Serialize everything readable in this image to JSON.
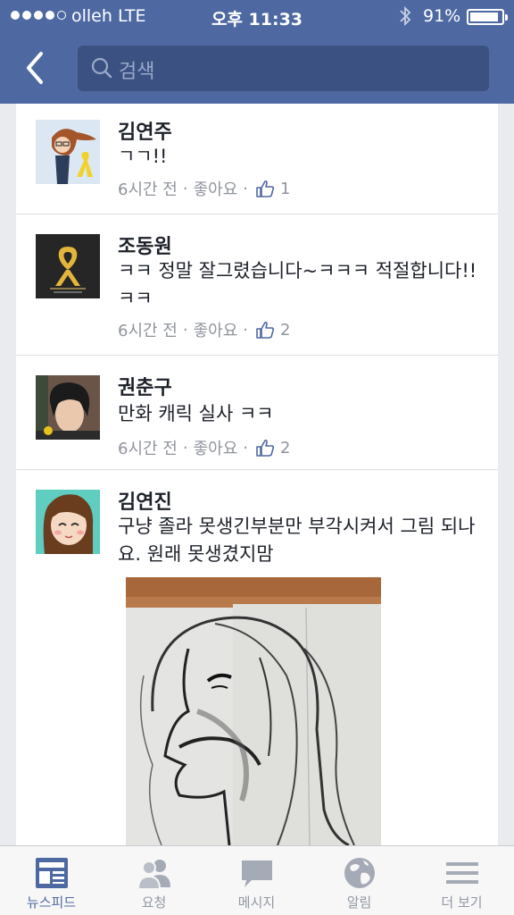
{
  "status_bar": {
    "carrier": "olleh  LTE",
    "time": "오후 11:33",
    "battery": "91%",
    "battery_level": 0.91
  },
  "nav": {
    "back_icon": "chevron-left-icon",
    "search_placeholder": "검색",
    "search_icon": "search-icon"
  },
  "comments": [
    {
      "name": "김연주",
      "text": "ㄱㄱ!!",
      "time": "6시간 전",
      "like_label": "좋아요",
      "separator": "·",
      "likes": "1"
    },
    {
      "name": "조동원",
      "text": "ㅋㅋ 정말 잘그렸습니다~ㅋㅋㅋ 적절합니다!!ㅋㅋ",
      "time": "6시간 전",
      "like_label": "좋아요",
      "separator": "·",
      "likes": "2"
    },
    {
      "name": "권춘구",
      "text": "만화 캐릭 실사 ㅋㅋ",
      "time": "6시간 전",
      "like_label": "좋아요",
      "separator": "·",
      "likes": "2"
    },
    {
      "name": "김연진",
      "text": "구냥 졸라 못생긴부분만 부각시켜서 그림 되나요. 원래 못생겼지맘"
    }
  ],
  "tabs": [
    {
      "label": "뉴스피드",
      "icon": "news-feed-icon",
      "active": true
    },
    {
      "label": "요청",
      "icon": "friend-requests-icon"
    },
    {
      "label": "메시지",
      "icon": "messages-icon"
    },
    {
      "label": "알림",
      "icon": "notifications-globe-icon"
    },
    {
      "label": "더 보기",
      "icon": "menu-icon"
    }
  ],
  "colors": {
    "brand": "#4e69a2",
    "active_tab": "#4e69a2",
    "inactive_tab": "#9197a3"
  }
}
